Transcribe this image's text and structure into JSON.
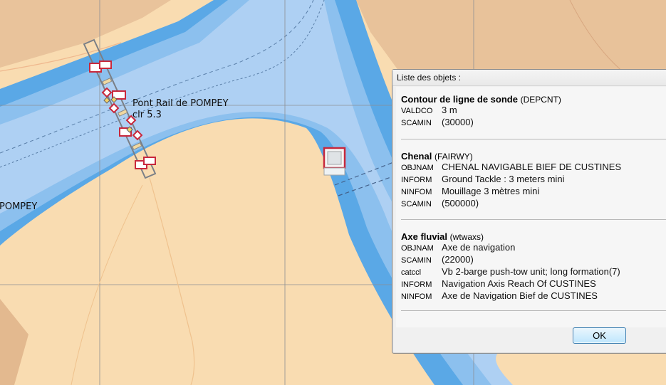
{
  "map": {
    "bridge_name": "Pont Rail de POMPEY",
    "bridge_clearance": "clr  5.3",
    "place_label": "POMPEY"
  },
  "dialog": {
    "title": "Liste des objets :",
    "ok_label": "OK",
    "sections": [
      {
        "name": "Contour de ligne de sonde",
        "code": "(DEPCNT)",
        "attributes": [
          {
            "key": "VALDCO",
            "value": "3 m"
          },
          {
            "key": "SCAMIN",
            "value": "(30000)"
          }
        ]
      },
      {
        "name": "Chenal",
        "code": "(FAIRWY)",
        "attributes": [
          {
            "key": "OBJNAM",
            "value": "CHENAL NAVIGABLE BIEF DE CUSTINES"
          },
          {
            "key": "INFORM",
            "value": "Ground Tackle : 3 meters mini"
          },
          {
            "key": "NINFOM",
            "value": "Mouillage 3 mètres mini"
          },
          {
            "key": "SCAMIN",
            "value": "(500000)"
          }
        ]
      },
      {
        "name": "Axe fluvial",
        "code": "(wtwaxs)",
        "attributes": [
          {
            "key": "OBJNAM",
            "value": "Axe de navigation"
          },
          {
            "key": "SCAMIN",
            "value": "(22000)"
          },
          {
            "key": "catccl",
            "value": "Vb 2-barge push-tow unit; long formation(7)"
          },
          {
            "key": "INFORM",
            "value": "Navigation Axis Reach Of CUSTINES"
          },
          {
            "key": "NINFOM",
            "value": "Axe de Navigation Bief de CUSTINES"
          }
        ]
      }
    ]
  },
  "colors": {
    "land": "#f9dcb1",
    "land_dark": "#e6bf95",
    "water_deep": "#5aa8e6",
    "water_mid": "#8cc0ee",
    "water_shallow": "#aed0f3",
    "beacon_red": "#c8283c"
  }
}
